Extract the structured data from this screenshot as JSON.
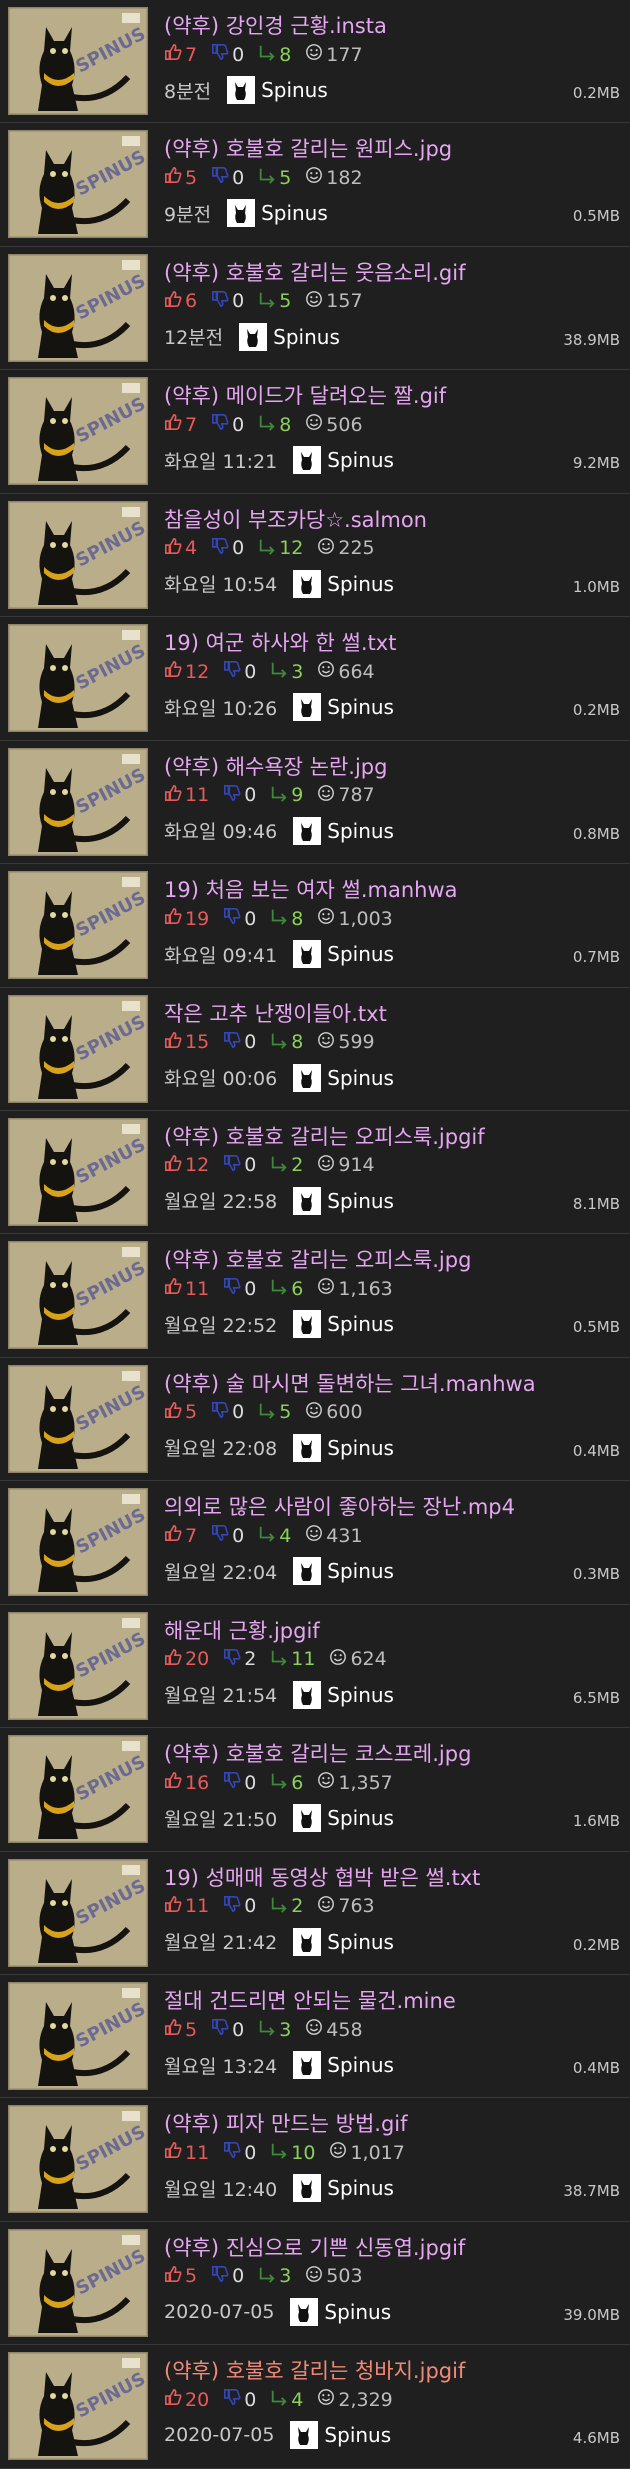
{
  "posts": [
    {
      "title": "(약후) 강인경 근황.insta",
      "title_color": "#e6a6f2",
      "up": "7",
      "down": "0",
      "rec": "8",
      "views": "177",
      "time": "8분전",
      "author": "Spinus",
      "size": "0.2MB"
    },
    {
      "title": "(약후) 호불호 갈리는 원피스.jpg",
      "title_color": "#e6a6f2",
      "up": "5",
      "down": "0",
      "rec": "5",
      "views": "182",
      "time": "9분전",
      "author": "Spinus",
      "size": "0.5MB"
    },
    {
      "title": "(약후) 호불호 갈리는 웃음소리.gif",
      "title_color": "#e6a6f2",
      "up": "6",
      "down": "0",
      "rec": "5",
      "views": "157",
      "time": "12분전",
      "author": "Spinus",
      "size": "38.9MB"
    },
    {
      "title": "(약후) 메이드가 달려오는 짤.gif",
      "title_color": "#e6a6f2",
      "up": "7",
      "down": "0",
      "rec": "8",
      "views": "506",
      "time": "화요일 11:21",
      "author": "Spinus",
      "size": "9.2MB"
    },
    {
      "title": "참을성이 부조카당☆.salmon",
      "title_color": "#e6a6f2",
      "up": "4",
      "down": "0",
      "rec": "12",
      "views": "225",
      "time": "화요일 10:54",
      "author": "Spinus",
      "size": "1.0MB"
    },
    {
      "title": "19) 여군 하사와 한 썰.txt",
      "title_color": "#e6a6f2",
      "up": "12",
      "down": "0",
      "rec": "3",
      "views": "664",
      "time": "화요일 10:26",
      "author": "Spinus",
      "size": "0.2MB"
    },
    {
      "title": "(약후) 해수욕장 논란.jpg",
      "title_color": "#e6a6f2",
      "up": "11",
      "down": "0",
      "rec": "9",
      "views": "787",
      "time": "화요일 09:46",
      "author": "Spinus",
      "size": "0.8MB"
    },
    {
      "title": "19) 처음 보는 여자 썰.manhwa",
      "title_color": "#e6a6f2",
      "up": "19",
      "down": "0",
      "rec": "8",
      "views": "1,003",
      "time": "화요일 09:41",
      "author": "Spinus",
      "size": "0.7MB"
    },
    {
      "title": "작은 고추 난쟁이들아.txt",
      "title_color": "#e6a6f2",
      "up": "15",
      "down": "0",
      "rec": "8",
      "views": "599",
      "time": "화요일 00:06",
      "author": "Spinus",
      "size": ""
    },
    {
      "title": "(약후) 호불호 갈리는 오피스룩.jpgif",
      "title_color": "#e6a6f2",
      "up": "12",
      "down": "0",
      "rec": "2",
      "views": "914",
      "time": "월요일 22:58",
      "author": "Spinus",
      "size": "8.1MB"
    },
    {
      "title": "(약후) 호불호 갈리는 오피스룩.jpg",
      "title_color": "#e6a6f2",
      "up": "11",
      "down": "0",
      "rec": "6",
      "views": "1,163",
      "time": "월요일 22:52",
      "author": "Spinus",
      "size": "0.5MB"
    },
    {
      "title": "(약후) 술 마시면 돌변하는 그녀.manhwa",
      "title_color": "#e6a6f2",
      "up": "5",
      "down": "0",
      "rec": "5",
      "views": "600",
      "time": "월요일 22:08",
      "author": "Spinus",
      "size": "0.4MB"
    },
    {
      "title": "의외로 많은 사람이 좋아하는 장난.mp4",
      "title_color": "#e6a6f2",
      "up": "7",
      "down": "0",
      "rec": "4",
      "views": "431",
      "time": "월요일 22:04",
      "author": "Spinus",
      "size": "0.3MB"
    },
    {
      "title": "해운대 근황.jpgif",
      "title_color": "#e6a6f2",
      "up": "20",
      "down": "2",
      "rec": "11",
      "views": "624",
      "time": "월요일 21:54",
      "author": "Spinus",
      "size": "6.5MB"
    },
    {
      "title": "(약후) 호불호 갈리는 코스프레.jpg",
      "title_color": "#e6a6f2",
      "up": "16",
      "down": "0",
      "rec": "6",
      "views": "1,357",
      "time": "월요일 21:50",
      "author": "Spinus",
      "size": "1.6MB"
    },
    {
      "title": "19) 성매매 동영상 협박 받은 썰.txt",
      "title_color": "#e6a6f2",
      "up": "11",
      "down": "0",
      "rec": "2",
      "views": "763",
      "time": "월요일 21:42",
      "author": "Spinus",
      "size": "0.2MB"
    },
    {
      "title": "절대 건드리면 안되는 물건.mine",
      "title_color": "#e6a6f2",
      "up": "5",
      "down": "0",
      "rec": "3",
      "views": "458",
      "time": "월요일 13:24",
      "author": "Spinus",
      "size": "0.4MB"
    },
    {
      "title": "(약후) 피자 만드는 방법.gif",
      "title_color": "#e6a6f2",
      "up": "11",
      "down": "0",
      "rec": "10",
      "views": "1,017",
      "time": "월요일 12:40",
      "author": "Spinus",
      "size": "38.7MB"
    },
    {
      "title": "(약후) 진심으로 기쁜 신동엽.jpgif",
      "title_color": "#e6a6f2",
      "up": "5",
      "down": "0",
      "rec": "3",
      "views": "503",
      "time": "2020-07-05",
      "author": "Spinus",
      "size": "39.0MB"
    },
    {
      "title": "(약후) 호불호 갈리는 청바지.jpgif",
      "title_color": "#f08a78",
      "up": "20",
      "down": "0",
      "rec": "4",
      "views": "2,329",
      "time": "2020-07-05",
      "author": "Spinus",
      "size": "4.6MB"
    }
  ],
  "icons": {
    "up": "thumbs-up-icon",
    "down": "thumbs-down-icon",
    "rec": "recommend-icon",
    "views": "smiley-icon"
  },
  "thumbnail_text": "SPINUS"
}
